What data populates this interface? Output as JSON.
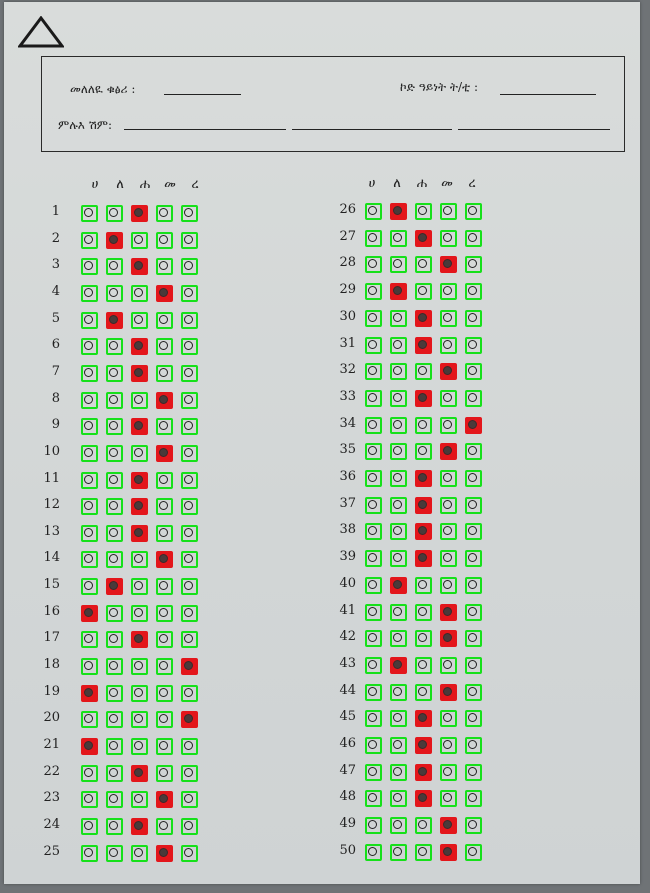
{
  "form": {
    "label_id": "መለለዪ ቁፅሪ :",
    "label_code": "ኮድ ዓይነት ት/ቲ :",
    "label_name": "ምሉእ ሽም:"
  },
  "options": [
    "ሀ",
    "ለ",
    "ሐ",
    "መ",
    "ረ"
  ],
  "answers": [
    {
      "q": "1",
      "a": 2
    },
    {
      "q": "2",
      "a": 1
    },
    {
      "q": "3",
      "a": 2
    },
    {
      "q": "4",
      "a": 3
    },
    {
      "q": "5",
      "a": 1
    },
    {
      "q": "6",
      "a": 2
    },
    {
      "q": "7",
      "a": 2
    },
    {
      "q": "8",
      "a": 3
    },
    {
      "q": "9",
      "a": 2
    },
    {
      "q": "10",
      "a": 3
    },
    {
      "q": "11",
      "a": 2
    },
    {
      "q": "12",
      "a": 2
    },
    {
      "q": "13",
      "a": 2
    },
    {
      "q": "14",
      "a": 3
    },
    {
      "q": "15",
      "a": 1
    },
    {
      "q": "16",
      "a": 0
    },
    {
      "q": "17",
      "a": 2
    },
    {
      "q": "18",
      "a": 4
    },
    {
      "q": "19",
      "a": 0
    },
    {
      "q": "20",
      "a": 4
    },
    {
      "q": "21",
      "a": 0
    },
    {
      "q": "22",
      "a": 2
    },
    {
      "q": "23",
      "a": 3
    },
    {
      "q": "24",
      "a": 2
    },
    {
      "q": "25",
      "a": 3
    },
    {
      "q": "26",
      "a": 1
    },
    {
      "q": "27",
      "a": 2
    },
    {
      "q": "28",
      "a": 3
    },
    {
      "q": "29",
      "a": 1
    },
    {
      "q": "30",
      "a": 2
    },
    {
      "q": "31",
      "a": 2
    },
    {
      "q": "32",
      "a": 3
    },
    {
      "q": "33",
      "a": 2
    },
    {
      "q": "34",
      "a": 4
    },
    {
      "q": "35",
      "a": 3
    },
    {
      "q": "36",
      "a": 2
    },
    {
      "q": "37",
      "a": 2
    },
    {
      "q": "38",
      "a": 2
    },
    {
      "q": "39",
      "a": 2
    },
    {
      "q": "40",
      "a": 1
    },
    {
      "q": "41",
      "a": 3
    },
    {
      "q": "42",
      "a": 3
    },
    {
      "q": "43",
      "a": 1
    },
    {
      "q": "44",
      "a": 3
    },
    {
      "q": "45",
      "a": 2
    },
    {
      "q": "46",
      "a": 2
    },
    {
      "q": "47",
      "a": 2
    },
    {
      "q": "48",
      "a": 2
    },
    {
      "q": "49",
      "a": 3
    },
    {
      "q": "50",
      "a": 3
    }
  ],
  "colors": {
    "selected": "#e3161b",
    "detected": "#16e01a"
  }
}
